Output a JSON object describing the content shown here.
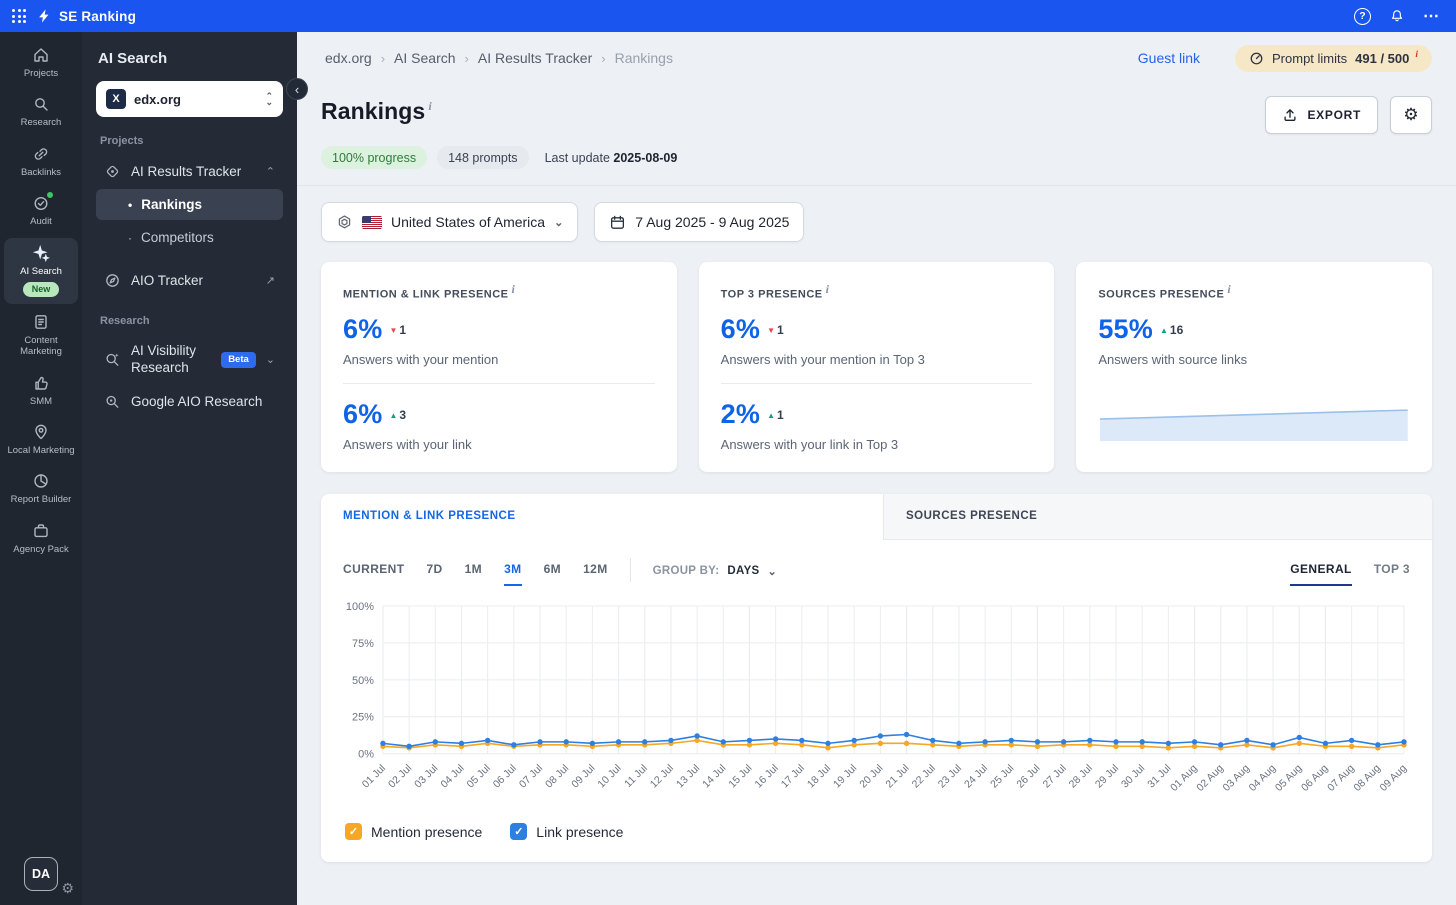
{
  "colors": {
    "topbar": "#1A55F0",
    "accent_blue": "#1566E8",
    "stat_blue": "#0E63E8",
    "delta_up": "#0BA47E",
    "delta_down": "#E5484D",
    "mention_orange": "#F6A723",
    "link_blue": "#2D7FE0",
    "progress_green_bg": "#DCF2DF",
    "progress_green_text": "#2E7D3A",
    "prompt_pill_bg": "#F6E8C6",
    "sidebar_bg": "#252B36",
    "rail_bg": "#20262F"
  },
  "icons": {
    "help": "?",
    "more": "⋯",
    "sep": "›",
    "collapse": "‹",
    "chevron_down": "⌄",
    "chevron_up": "⌃",
    "external": "↗",
    "bullet": "•",
    "dot": "·",
    "up_triangle": "▲",
    "down_triangle": "▼",
    "check": "✓",
    "info": "i",
    "gear": "⚙"
  },
  "topbar": {
    "brand": "SE Ranking"
  },
  "nav_rail": {
    "items": [
      {
        "label": "Projects"
      },
      {
        "label": "Research"
      },
      {
        "label": "Backlinks"
      },
      {
        "label": "Audit"
      },
      {
        "label": "AI Search",
        "badge": "New"
      },
      {
        "label": "Content Marketing"
      },
      {
        "label": "SMM"
      },
      {
        "label": "Local Marketing"
      },
      {
        "label": "Report Builder"
      },
      {
        "label": "Agency Pack"
      }
    ],
    "avatar": "DA"
  },
  "sidebar": {
    "title": "AI Search",
    "project": "edx.org",
    "project_initial": "X",
    "section_projects": "Projects",
    "section_research": "Research",
    "items": {
      "ai_results_tracker": "AI Results Tracker",
      "rankings": "Rankings",
      "competitors": "Competitors",
      "aio_tracker": "AIO Tracker",
      "ai_visibility_research": "AI Visibility Research",
      "beta": "Beta",
      "google_aio_research": "Google AIO Research"
    }
  },
  "breadcrumb": {
    "items": [
      "edx.org",
      "AI Search",
      "AI Results Tracker",
      "Rankings"
    ]
  },
  "header_bar": {
    "guest_link": "Guest link",
    "prompt_limits_label": "Prompt limits",
    "prompt_limits_value": "491 / 500"
  },
  "page": {
    "title": "Rankings",
    "progress_badge": "100% progress",
    "prompts_badge": "148 prompts",
    "last_update_label": "Last update",
    "last_update_date": "2025-08-09",
    "export_label": "EXPORT"
  },
  "filters": {
    "engine_region": "United States of America",
    "date_range": "7 Aug 2025 - 9 Aug 2025"
  },
  "stats": {
    "mention_link": {
      "title": "MENTION & LINK PRESENCE",
      "rows": [
        {
          "value": "6%",
          "delta": "1",
          "direction": "down",
          "caption": "Answers with your mention"
        },
        {
          "value": "6%",
          "delta": "3",
          "direction": "up",
          "caption": "Answers with your link"
        }
      ]
    },
    "top3": {
      "title": "TOP 3 PRESENCE",
      "rows": [
        {
          "value": "6%",
          "delta": "1",
          "direction": "down",
          "caption": "Answers with your mention in Top 3"
        },
        {
          "value": "2%",
          "delta": "1",
          "direction": "up",
          "caption": "Answers with your link in Top 3"
        }
      ]
    },
    "sources": {
      "title": "SOURCES PRESENCE",
      "value": "55%",
      "delta": "16",
      "direction": "up",
      "caption": "Answers with source links"
    }
  },
  "chart_panel": {
    "tab_mention": "MENTION & LINK PRESENCE",
    "tab_sources": "SOURCES PRESENCE",
    "ranges": [
      "CURRENT",
      "7D",
      "1M",
      "3M",
      "6M",
      "12M"
    ],
    "active_range": "3M",
    "group_by_label": "GROUP BY:",
    "group_by_value": "DAYS",
    "view_general": "GENERAL",
    "view_top3": "TOP 3",
    "legend": [
      {
        "label": "Mention presence",
        "color": "#F6A723",
        "checked": true
      },
      {
        "label": "Link presence",
        "color": "#2D7FE0",
        "checked": true
      }
    ]
  },
  "chart_data": [
    {
      "type": "line",
      "title": "Mention & Link presence by day",
      "x": [
        "01 Jul",
        "02 Jul",
        "03 Jul",
        "04 Jul",
        "05 Jul",
        "06 Jul",
        "07 Jul",
        "08 Jul",
        "09 Jul",
        "10 Jul",
        "11 Jul",
        "12 Jul",
        "13 Jul",
        "14 Jul",
        "15 Jul",
        "16 Jul",
        "17 Jul",
        "18 Jul",
        "19 Jul",
        "20 Jul",
        "21 Jul",
        "22 Jul",
        "23 Jul",
        "24 Jul",
        "25 Jul",
        "26 Jul",
        "27 Jul",
        "28 Jul",
        "29 Jul",
        "30 Jul",
        "31 Jul",
        "01 Aug",
        "02 Aug",
        "03 Aug",
        "04 Aug",
        "05 Aug",
        "06 Aug",
        "07 Aug",
        "08 Aug",
        "09 Aug"
      ],
      "series": [
        {
          "name": "Mention presence",
          "color": "#F6A723",
          "values": [
            5,
            4,
            6,
            5,
            7,
            5,
            6,
            6,
            5,
            6,
            6,
            7,
            9,
            6,
            6,
            7,
            6,
            4,
            6,
            7,
            7,
            6,
            5,
            6,
            6,
            5,
            6,
            6,
            5,
            5,
            4,
            5,
            4,
            6,
            4,
            7,
            5,
            5,
            4,
            6
          ]
        },
        {
          "name": "Link presence",
          "color": "#2D7FE0",
          "values": [
            7,
            5,
            8,
            7,
            9,
            6,
            8,
            8,
            7,
            8,
            8,
            9,
            12,
            8,
            9,
            10,
            9,
            7,
            9,
            12,
            13,
            9,
            7,
            8,
            9,
            8,
            8,
            9,
            8,
            8,
            7,
            8,
            6,
            9,
            6,
            11,
            7,
            9,
            6,
            8
          ]
        }
      ],
      "ylim": [
        0,
        100
      ],
      "yticks": [
        0,
        25,
        50,
        75,
        100
      ],
      "grid": true,
      "legend_position": "bottom"
    },
    {
      "type": "area",
      "title": "Sources presence trend",
      "values": [
        40,
        42,
        44,
        46,
        48,
        50,
        52,
        54,
        56,
        58
      ],
      "color": "#9CC0EC",
      "fill": "#DCE9F8",
      "ylim": [
        0,
        100
      ]
    }
  ]
}
